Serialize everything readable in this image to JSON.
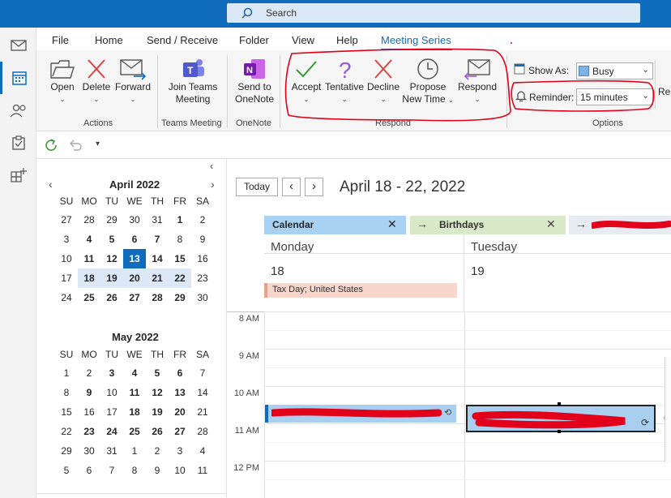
{
  "search": {
    "placeholder": "Search"
  },
  "menu": [
    "File",
    "Home",
    "Send / Receive",
    "Folder",
    "View",
    "Help",
    "Meeting Series"
  ],
  "ribbon": {
    "open": "Open",
    "delete": "Delete",
    "forward": "Forward",
    "actions": "Actions",
    "join_line1": "Join Teams",
    "join_line2": "Meeting",
    "teams_group": "Teams Meeting",
    "send_line1": "Send to",
    "send_line2": "OneNote",
    "onenote_group": "OneNote",
    "accept": "Accept",
    "tentative": "Tentative",
    "decline": "Decline",
    "propose_line1": "Propose",
    "propose_line2": "New Time",
    "respond": "Respond",
    "respond_group": "Respond",
    "show_as_label": "Show As:",
    "show_as_value": "Busy",
    "reminder_label": "Reminder:",
    "reminder_value": "15 minutes",
    "options_group": "Options",
    "truncated": "Re"
  },
  "quick_access_caret": "▾",
  "mini_calendar": {
    "day_headers": [
      "SU",
      "MO",
      "TU",
      "WE",
      "TH",
      "FR",
      "SA"
    ],
    "april": {
      "title": "April 2022",
      "weeks": [
        [
          "27",
          "28",
          "29",
          "30",
          "31",
          "1",
          "2"
        ],
        [
          "3",
          "4",
          "5",
          "6",
          "7",
          "8",
          "9"
        ],
        [
          "10",
          "11",
          "12",
          "13",
          "14",
          "15",
          "16"
        ],
        [
          "17",
          "18",
          "19",
          "20",
          "21",
          "22",
          "23"
        ],
        [
          "24",
          "25",
          "26",
          "27",
          "28",
          "29",
          "30"
        ]
      ]
    },
    "may": {
      "title": "May 2022",
      "weeks": [
        [
          "1",
          "2",
          "3",
          "4",
          "5",
          "6",
          "7"
        ],
        [
          "8",
          "9",
          "10",
          "11",
          "12",
          "13",
          "14"
        ],
        [
          "15",
          "16",
          "17",
          "18",
          "19",
          "20",
          "21"
        ],
        [
          "22",
          "23",
          "24",
          "25",
          "26",
          "27",
          "28"
        ],
        [
          "29",
          "30",
          "31",
          "1",
          "2",
          "3",
          "4"
        ],
        [
          "5",
          "6",
          "7",
          "8",
          "9",
          "10",
          "11"
        ]
      ]
    }
  },
  "calendar": {
    "today_button": "Today",
    "date_range": "April 18 - 22, 2022",
    "tabs": [
      "Calendar",
      "Birthdays"
    ],
    "days": [
      {
        "name": "Monday",
        "date": "18"
      },
      {
        "name": "Tuesday",
        "date": "19"
      }
    ],
    "all_day_event": "Tax Day; United States",
    "hours": [
      "8 AM",
      "9 AM",
      "10 AM",
      "11 AM",
      "12 PM"
    ]
  },
  "colors": {
    "accent": "#0f6cbd",
    "annotation_red": "#e3001b",
    "event_blue": "#a9cef0",
    "tax_day": "#f8d6cb",
    "calendar_tab": "#a9d1f2",
    "birthday_tab": "#d7e9c7"
  }
}
